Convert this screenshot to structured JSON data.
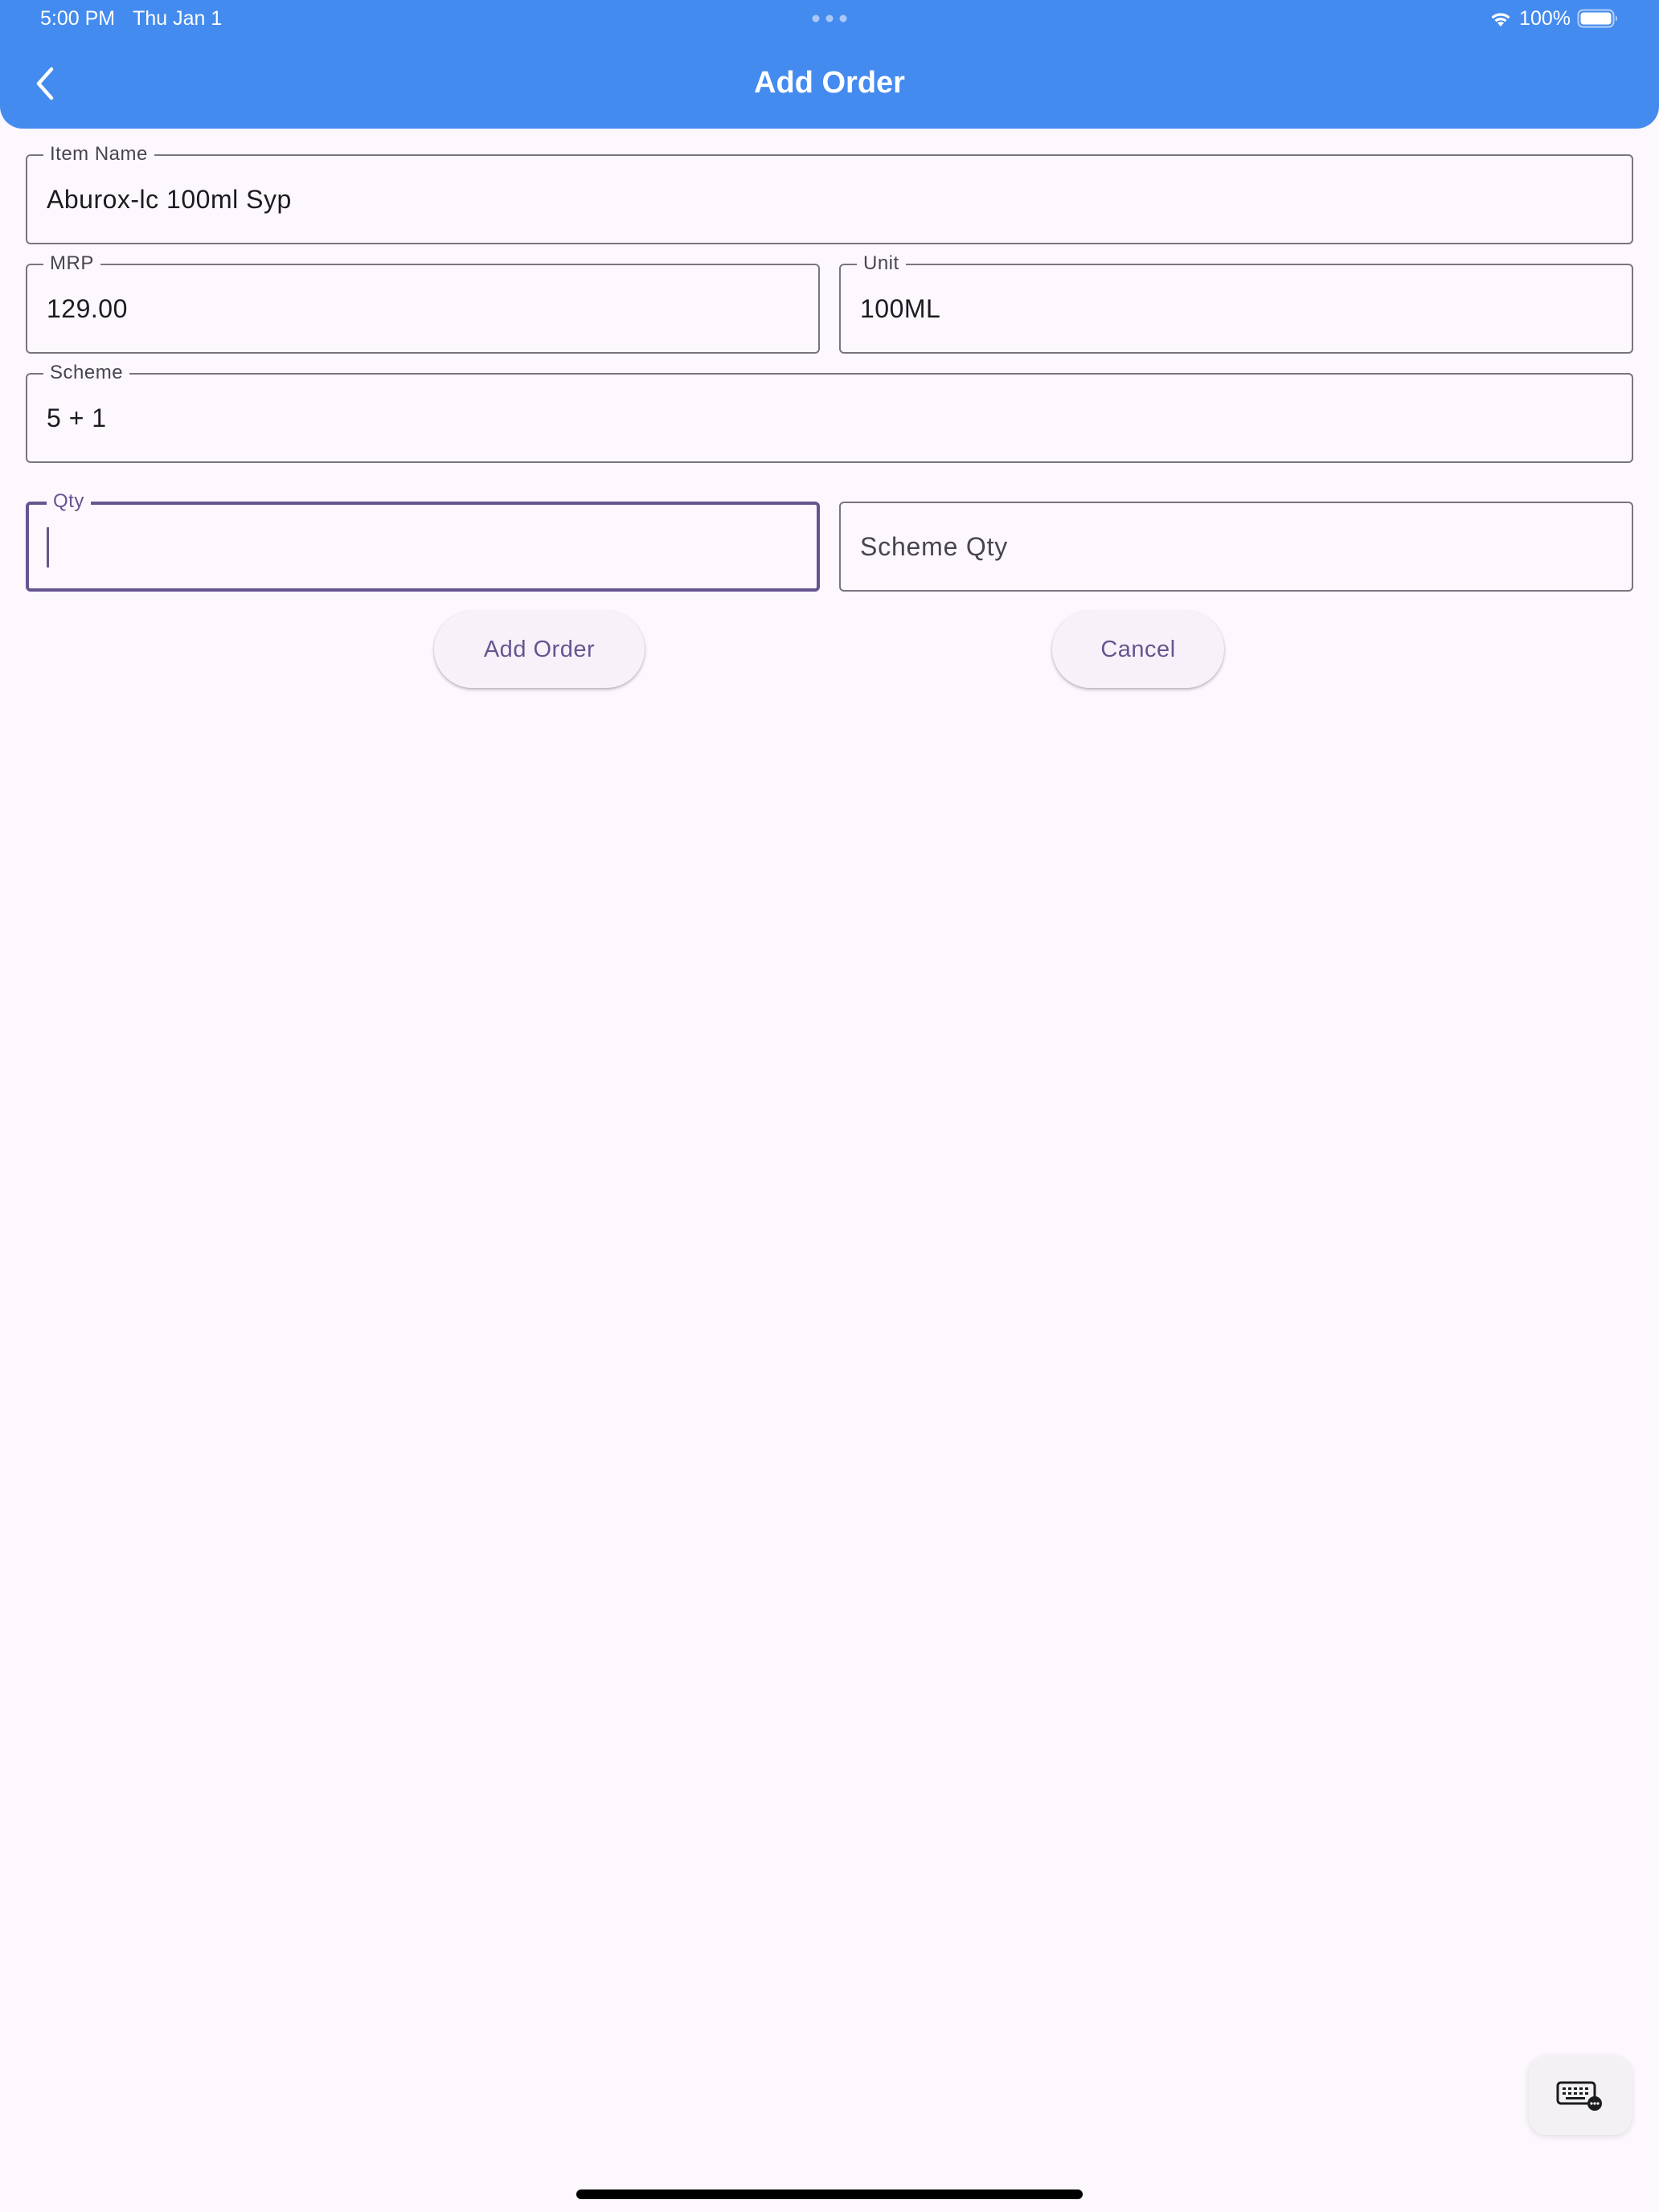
{
  "status_bar": {
    "time": "5:00 PM",
    "date": "Thu Jan 1",
    "battery": "100%",
    "icons": [
      "wifi-icon",
      "battery-icon"
    ]
  },
  "header": {
    "title": "Add Order",
    "back_icon": "chevron-left-icon",
    "background": "#448bef"
  },
  "form": {
    "item_name": {
      "label": "Item Name",
      "value": "Aburox-lc 100ml Syp"
    },
    "mrp": {
      "label": "MRP",
      "value": "129.00"
    },
    "unit": {
      "label": "Unit",
      "value": "100ML"
    },
    "scheme": {
      "label": "Scheme",
      "value": "5 + 1"
    },
    "qty": {
      "label": "Qty",
      "value": ""
    },
    "scheme_qty": {
      "placeholder": "Scheme Qty",
      "value": ""
    }
  },
  "actions": {
    "add_order_label": "Add Order",
    "cancel_label": "Cancel",
    "accent": "#65558f"
  },
  "keyboard_button": {
    "icon": "keyboard-icon"
  }
}
